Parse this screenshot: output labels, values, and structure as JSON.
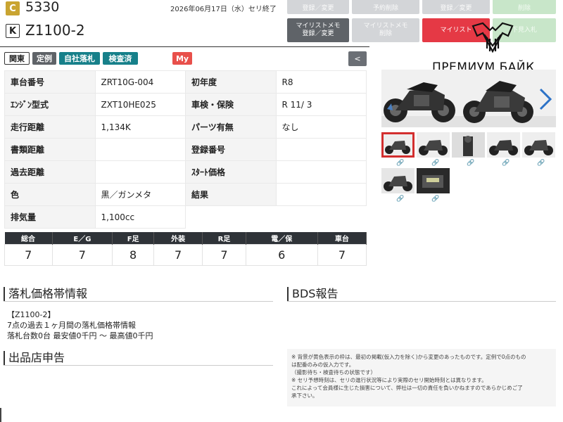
{
  "header": {
    "badge_c": "C",
    "lot_number": "5330",
    "badge_k": "K",
    "model": "Z1100-2",
    "auction_date": "2026年06月17日（水）セリ終了"
  },
  "top_buttons_row1": [
    {
      "label": "登録／変更"
    },
    {
      "label": "予約削除"
    },
    {
      "label": "登録／変更"
    },
    {
      "label": "削除"
    }
  ],
  "top_buttons_row2": [
    {
      "label": "マイリストメモ\n登録／変更"
    },
    {
      "label": "マイリストメモ\n削除"
    },
    {
      "label": "マイリスト"
    },
    {
      "label": "下見入札"
    }
  ],
  "logo": {
    "text": "ПРЕМИУМ БАЙК"
  },
  "tags": {
    "region": "関東",
    "regular": "定例",
    "own_bid": "自社落札",
    "inspected": "検査済",
    "my": "My",
    "collapse": "<"
  },
  "spec_rows": [
    {
      "l1": "車台番号",
      "v1": "ZRT10G-004",
      "l2": "初年度",
      "v2": "R8"
    },
    {
      "l1": "ｴﾝｼﾞﾝ型式",
      "v1": "ZXT10HE025",
      "l2": "車検・保険",
      "v2": "R 11/ 3"
    },
    {
      "l1": "走行距離",
      "v1": "1,134K",
      "l2": "パーツ有無",
      "v2": "なし"
    },
    {
      "l1": "書類距離",
      "v1": "",
      "l2": "登録番号",
      "v2": ""
    },
    {
      "l1": "過去距離",
      "v1": "",
      "l2": "ｽﾀｰﾄ価格",
      "v2": ""
    },
    {
      "l1": "色",
      "v1": "黒／ガンメタ",
      "l2": "結果",
      "v2": ""
    },
    {
      "l1": "排気量",
      "v1": "1,100cc"
    }
  ],
  "scores": {
    "headers": [
      "総合",
      "E／G",
      "F足",
      "外装",
      "R足",
      "電／保",
      "車台"
    ],
    "values": [
      "7",
      "7",
      "8",
      "7",
      "7",
      "6",
      "7"
    ]
  },
  "price_section": {
    "title": "落札価格帯情報",
    "model_line": "【Z1100-2】",
    "line2": "7点の過去１ヶ月間の落札価格帯情報",
    "line3": "落札台数0台 最安値0千円 〜 最高値0千円"
  },
  "bds_section": {
    "title": "BDS報告"
  },
  "store_section": {
    "title": "出品店申告"
  },
  "notes": [
    "※ 背景が黄色表示の枠は、最初の掲載(仮入力を除く)から変更のあったものです。定例で0点のもの",
    "は配番のみの仮入力です。",
    "（撮影待ち・検査待ちの状態です）",
    "※ セリ予想時刻は、セリの進行状況等により実際のセリ開始時刻とは異なります。",
    "これによって会員様に生じた損害について、弊社は一切の責任を負いかねますのであらかじめご了",
    "承下さい。"
  ],
  "photos": {
    "main_photo_count": 2,
    "thumbnail_count": 7,
    "selected_thumbnail": 1
  },
  "colors": {
    "teal_tag": "#17808a",
    "red_button": "#e53945",
    "dark_header": "#2f3338",
    "gold_badge": "#c9a431"
  }
}
